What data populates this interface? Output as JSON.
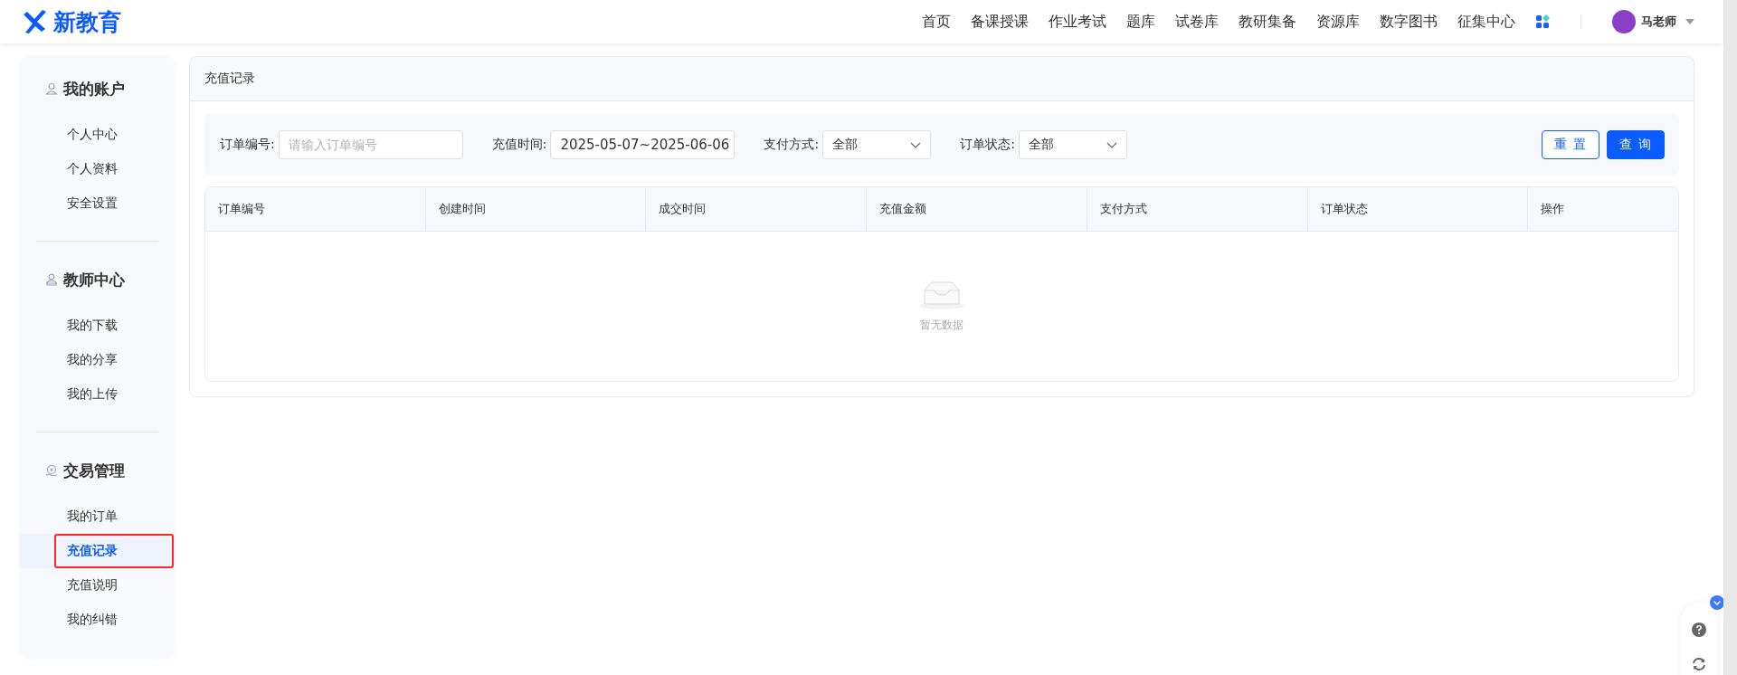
{
  "header": {
    "logo": "新教育",
    "nav": [
      "首页",
      "备课授课",
      "作业考试",
      "题库",
      "试卷库",
      "教研集备",
      "资源库",
      "数字图书",
      "征集中心"
    ],
    "user": "马老师"
  },
  "sidebar": [
    {
      "title": "我的账户",
      "items": [
        {
          "label": "个人中心",
          "selected": false,
          "outlined": false
        },
        {
          "label": "个人资料",
          "selected": false,
          "outlined": false
        },
        {
          "label": "安全设置",
          "selected": false,
          "outlined": false
        }
      ]
    },
    {
      "title": "教师中心",
      "items": [
        {
          "label": "我的下载",
          "selected": false,
          "outlined": false
        },
        {
          "label": "我的分享",
          "selected": false,
          "outlined": false
        },
        {
          "label": "我的上传",
          "selected": false,
          "outlined": false
        }
      ]
    },
    {
      "title": "交易管理",
      "items": [
        {
          "label": "我的订单",
          "selected": false,
          "outlined": false
        },
        {
          "label": "充值记录",
          "selected": true,
          "outlined": true
        },
        {
          "label": "充值说明",
          "selected": false,
          "outlined": false
        },
        {
          "label": "我的纠错",
          "selected": false,
          "outlined": false
        }
      ]
    }
  ],
  "panel": {
    "title": "充值记录",
    "filters": [
      {
        "kind": "input",
        "label": "订单编号:",
        "placeholder": "请输入订单编号"
      },
      {
        "kind": "date",
        "label": "充值时间:",
        "value": "2025-05-07~2025-06-06"
      },
      {
        "kind": "select",
        "label": "支付方式:",
        "value": "全部"
      },
      {
        "kind": "select",
        "label": "订单状态:",
        "value": "全部"
      }
    ],
    "buttons": [
      {
        "label": "重 置",
        "kind": "secondary"
      },
      {
        "label": "查 询",
        "kind": "primary"
      }
    ],
    "table": {
      "columns": [
        "订单编号",
        "创建时间",
        "成交时间",
        "充值金额",
        "支付方式",
        "订单状态",
        "操作"
      ],
      "empty_text": "暂无数据"
    }
  }
}
